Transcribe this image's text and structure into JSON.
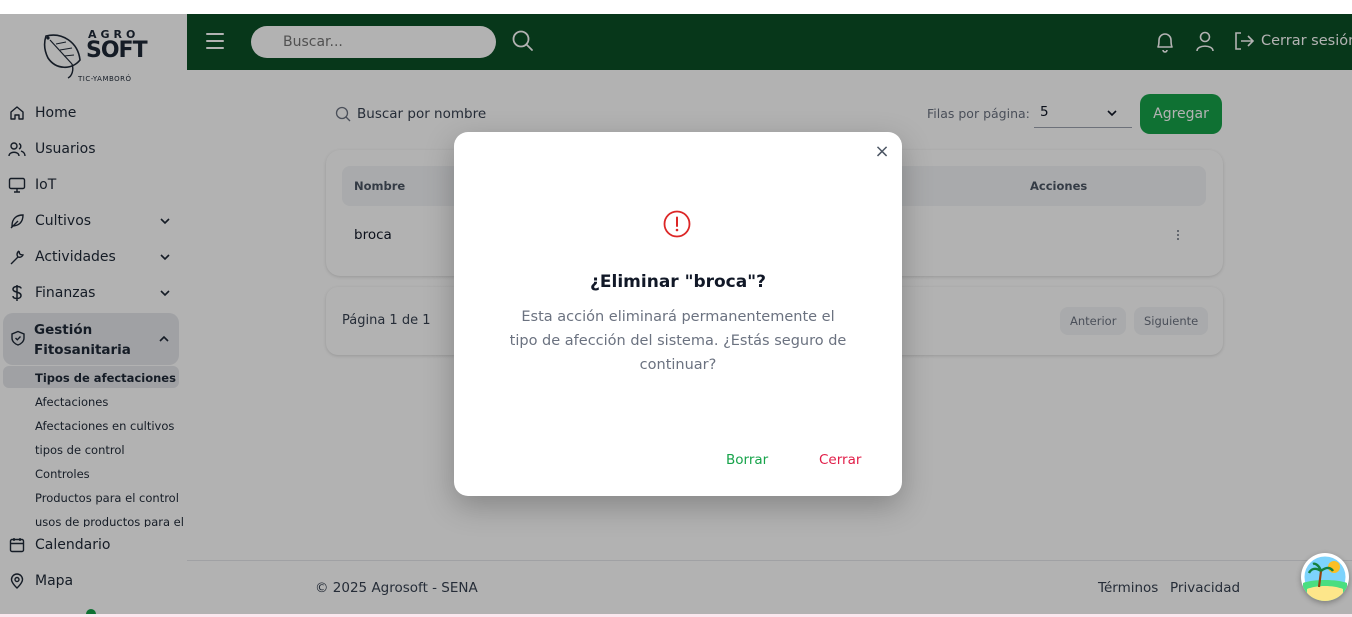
{
  "app": {
    "logo": {
      "top": "AGRO",
      "main": "SOFT",
      "sub": "TIC-YAMBORÓ"
    }
  },
  "header": {
    "search_placeholder": "Buscar...",
    "logout_label": "Cerrar sesión",
    "bg_color": "#0b4f26"
  },
  "sidebar": {
    "items": [
      {
        "label": "Home",
        "icon": "home-icon"
      },
      {
        "label": "Usuarios",
        "icon": "users-icon"
      },
      {
        "label": "IoT",
        "icon": "monitor-icon"
      },
      {
        "label": "Cultivos",
        "icon": "leaf-icon"
      },
      {
        "label": "Actividades",
        "icon": "wrench-icon"
      },
      {
        "label": "Finanzas",
        "icon": "dollar-icon"
      }
    ],
    "group": {
      "label": "Gestión Fitosanitaria",
      "icon": "shield-check-icon",
      "subitems": [
        "Tipos de afectaciones",
        "Afectaciones",
        "Afectaciones en cultivos",
        "tipos de control",
        "Controles",
        "Productos para el control",
        "usos de productos para el"
      ]
    },
    "bottom_items": [
      {
        "label": "Calendario",
        "icon": "calendar-icon"
      },
      {
        "label": "Mapa",
        "icon": "map-pin-icon"
      }
    ]
  },
  "content": {
    "search_placeholder": "Buscar por nombre",
    "rows_label": "Filas por página:",
    "rows_value": "5",
    "add_label": "Agregar",
    "table": {
      "columns": [
        "Nombre",
        "Acciones"
      ],
      "rows": [
        {
          "nombre": "broca"
        }
      ]
    },
    "pagination": {
      "info": "Página 1 de 1",
      "prev": "Anterior",
      "next": "Siguiente"
    }
  },
  "footer": {
    "copyright": "© 2025 Agrosoft - SENA",
    "terms": "Términos",
    "privacy": "Privacidad"
  },
  "modal": {
    "title": "¿Eliminar \"broca\"?",
    "body": "Esta acción eliminará permanentemente el tipo de afección del sistema. ¿Estás seguro de continuar?",
    "confirm_label": "Borrar",
    "cancel_label": "Cerrar",
    "close_symbol": "×",
    "confirm_color": "#16a34a",
    "cancel_color": "#e11d48",
    "warning_color": "#dc2626"
  }
}
